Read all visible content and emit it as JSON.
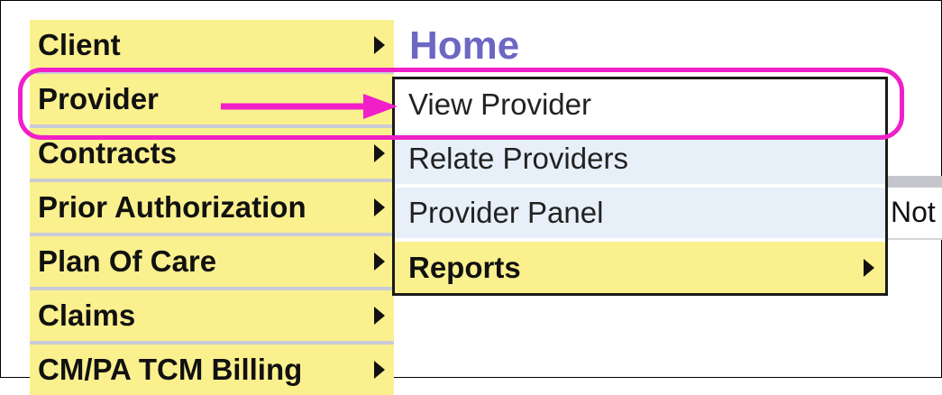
{
  "page": {
    "title": "Home"
  },
  "menu": {
    "items": [
      {
        "label": "Client",
        "has_submenu": true
      },
      {
        "label": "Provider",
        "has_submenu": true
      },
      {
        "label": "Contracts",
        "has_submenu": true
      },
      {
        "label": "Prior Authorization",
        "has_submenu": true
      },
      {
        "label": "Plan Of Care",
        "has_submenu": true
      },
      {
        "label": "Claims",
        "has_submenu": true
      },
      {
        "label": "CM/PA TCM Billing",
        "has_submenu": true
      }
    ]
  },
  "submenu": {
    "items": [
      {
        "label": "View Provider"
      },
      {
        "label": "Relate Providers"
      },
      {
        "label": "Provider Panel"
      },
      {
        "label": "Reports",
        "has_submenu": true
      }
    ]
  },
  "background": {
    "partial_text": "Not"
  },
  "annotation": {
    "color": "#f01fc8"
  },
  "colors": {
    "menu_bg": "#fbf08e",
    "title": "#6d67c4",
    "submenu_bg": "#e7f0f9"
  },
  "icons": {
    "submenu_arrow": "triangle-right-icon"
  }
}
